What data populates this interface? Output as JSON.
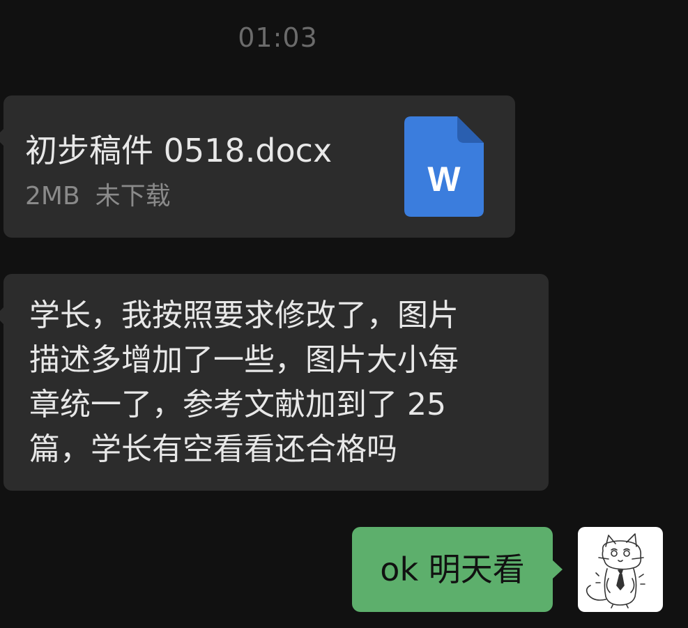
{
  "chat": {
    "timestamp": "01:03",
    "messages": [
      {
        "type": "file",
        "direction": "incoming",
        "file_name": "初步稿件 0518.docx",
        "file_size": "2MB",
        "download_status": "未下载",
        "file_icon": "word-doc-icon",
        "file_icon_letter": "W"
      },
      {
        "type": "text",
        "direction": "incoming",
        "lines": [
          "学长，我按照要求修改了，图片",
          "描述多增加了一些，图片大小每",
          "章统一了，参考文献加到了 25",
          "篇，学长有空看看还合格吗"
        ]
      },
      {
        "type": "text",
        "direction": "outgoing",
        "text": "ok 明天看",
        "avatar": "cat-sketch-avatar"
      }
    ]
  },
  "colors": {
    "background": "#111111",
    "incoming_bubble": "#2c2c2c",
    "outgoing_bubble": "#5daf6c",
    "word_icon": "#3b7ddd",
    "timestamp": "#6b6b6b"
  }
}
